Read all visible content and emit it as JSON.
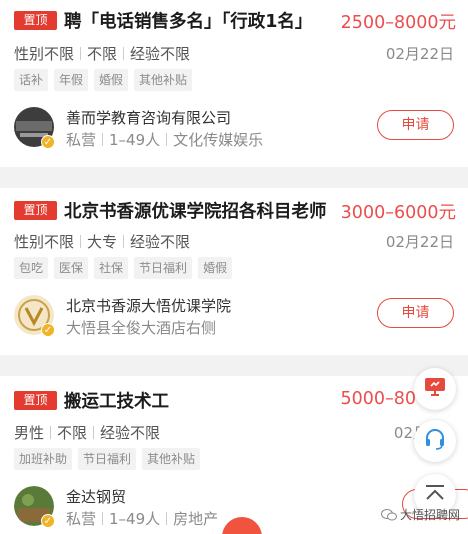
{
  "jobs": [
    {
      "badge": "置顶",
      "title": "聘「电话销售多名」「行政1名」",
      "salary": "2500–8000元",
      "req": [
        "性别不限",
        "不限",
        "经验不限"
      ],
      "date": "02月22日",
      "tags": [
        "话补",
        "年假",
        "婚假",
        "其他补贴"
      ],
      "company": "善而学教育咨询有限公司",
      "company_meta": [
        "私营",
        "1–49人",
        "文化传媒娱乐"
      ],
      "apply": "申请"
    },
    {
      "badge": "置顶",
      "title": "北京书香源优课学院招各科目老师",
      "salary": "3000–6000元",
      "req": [
        "性别不限",
        "大专",
        "经验不限"
      ],
      "date": "02月22日",
      "tags": [
        "包吃",
        "医保",
        "社保",
        "节日福利",
        "婚假"
      ],
      "company": "北京书香源大悟优课学院",
      "company_meta": [
        "大悟县全俊大酒店右侧"
      ],
      "apply": "申请"
    },
    {
      "badge": "置顶",
      "title": "搬运工技术工",
      "salary": "5000–80",
      "req": [
        "男性",
        "不限",
        "经验不限"
      ],
      "date": "02月",
      "tags": [
        "加班补助",
        "节日福利",
        "其他补贴"
      ],
      "company": "金达钢贸",
      "company_meta": [
        "私营",
        "1–49人",
        "房地产"
      ],
      "apply": "申"
    }
  ],
  "watermark": "大悟招聘网",
  "colors": {
    "accent": "#e33b2f",
    "salary": "#ec4d4d",
    "verify": "#f0b428"
  },
  "icons": [
    "monitor-icon",
    "headset-icon",
    "back-to-top-icon",
    "verified-icon",
    "wechat-icon"
  ]
}
